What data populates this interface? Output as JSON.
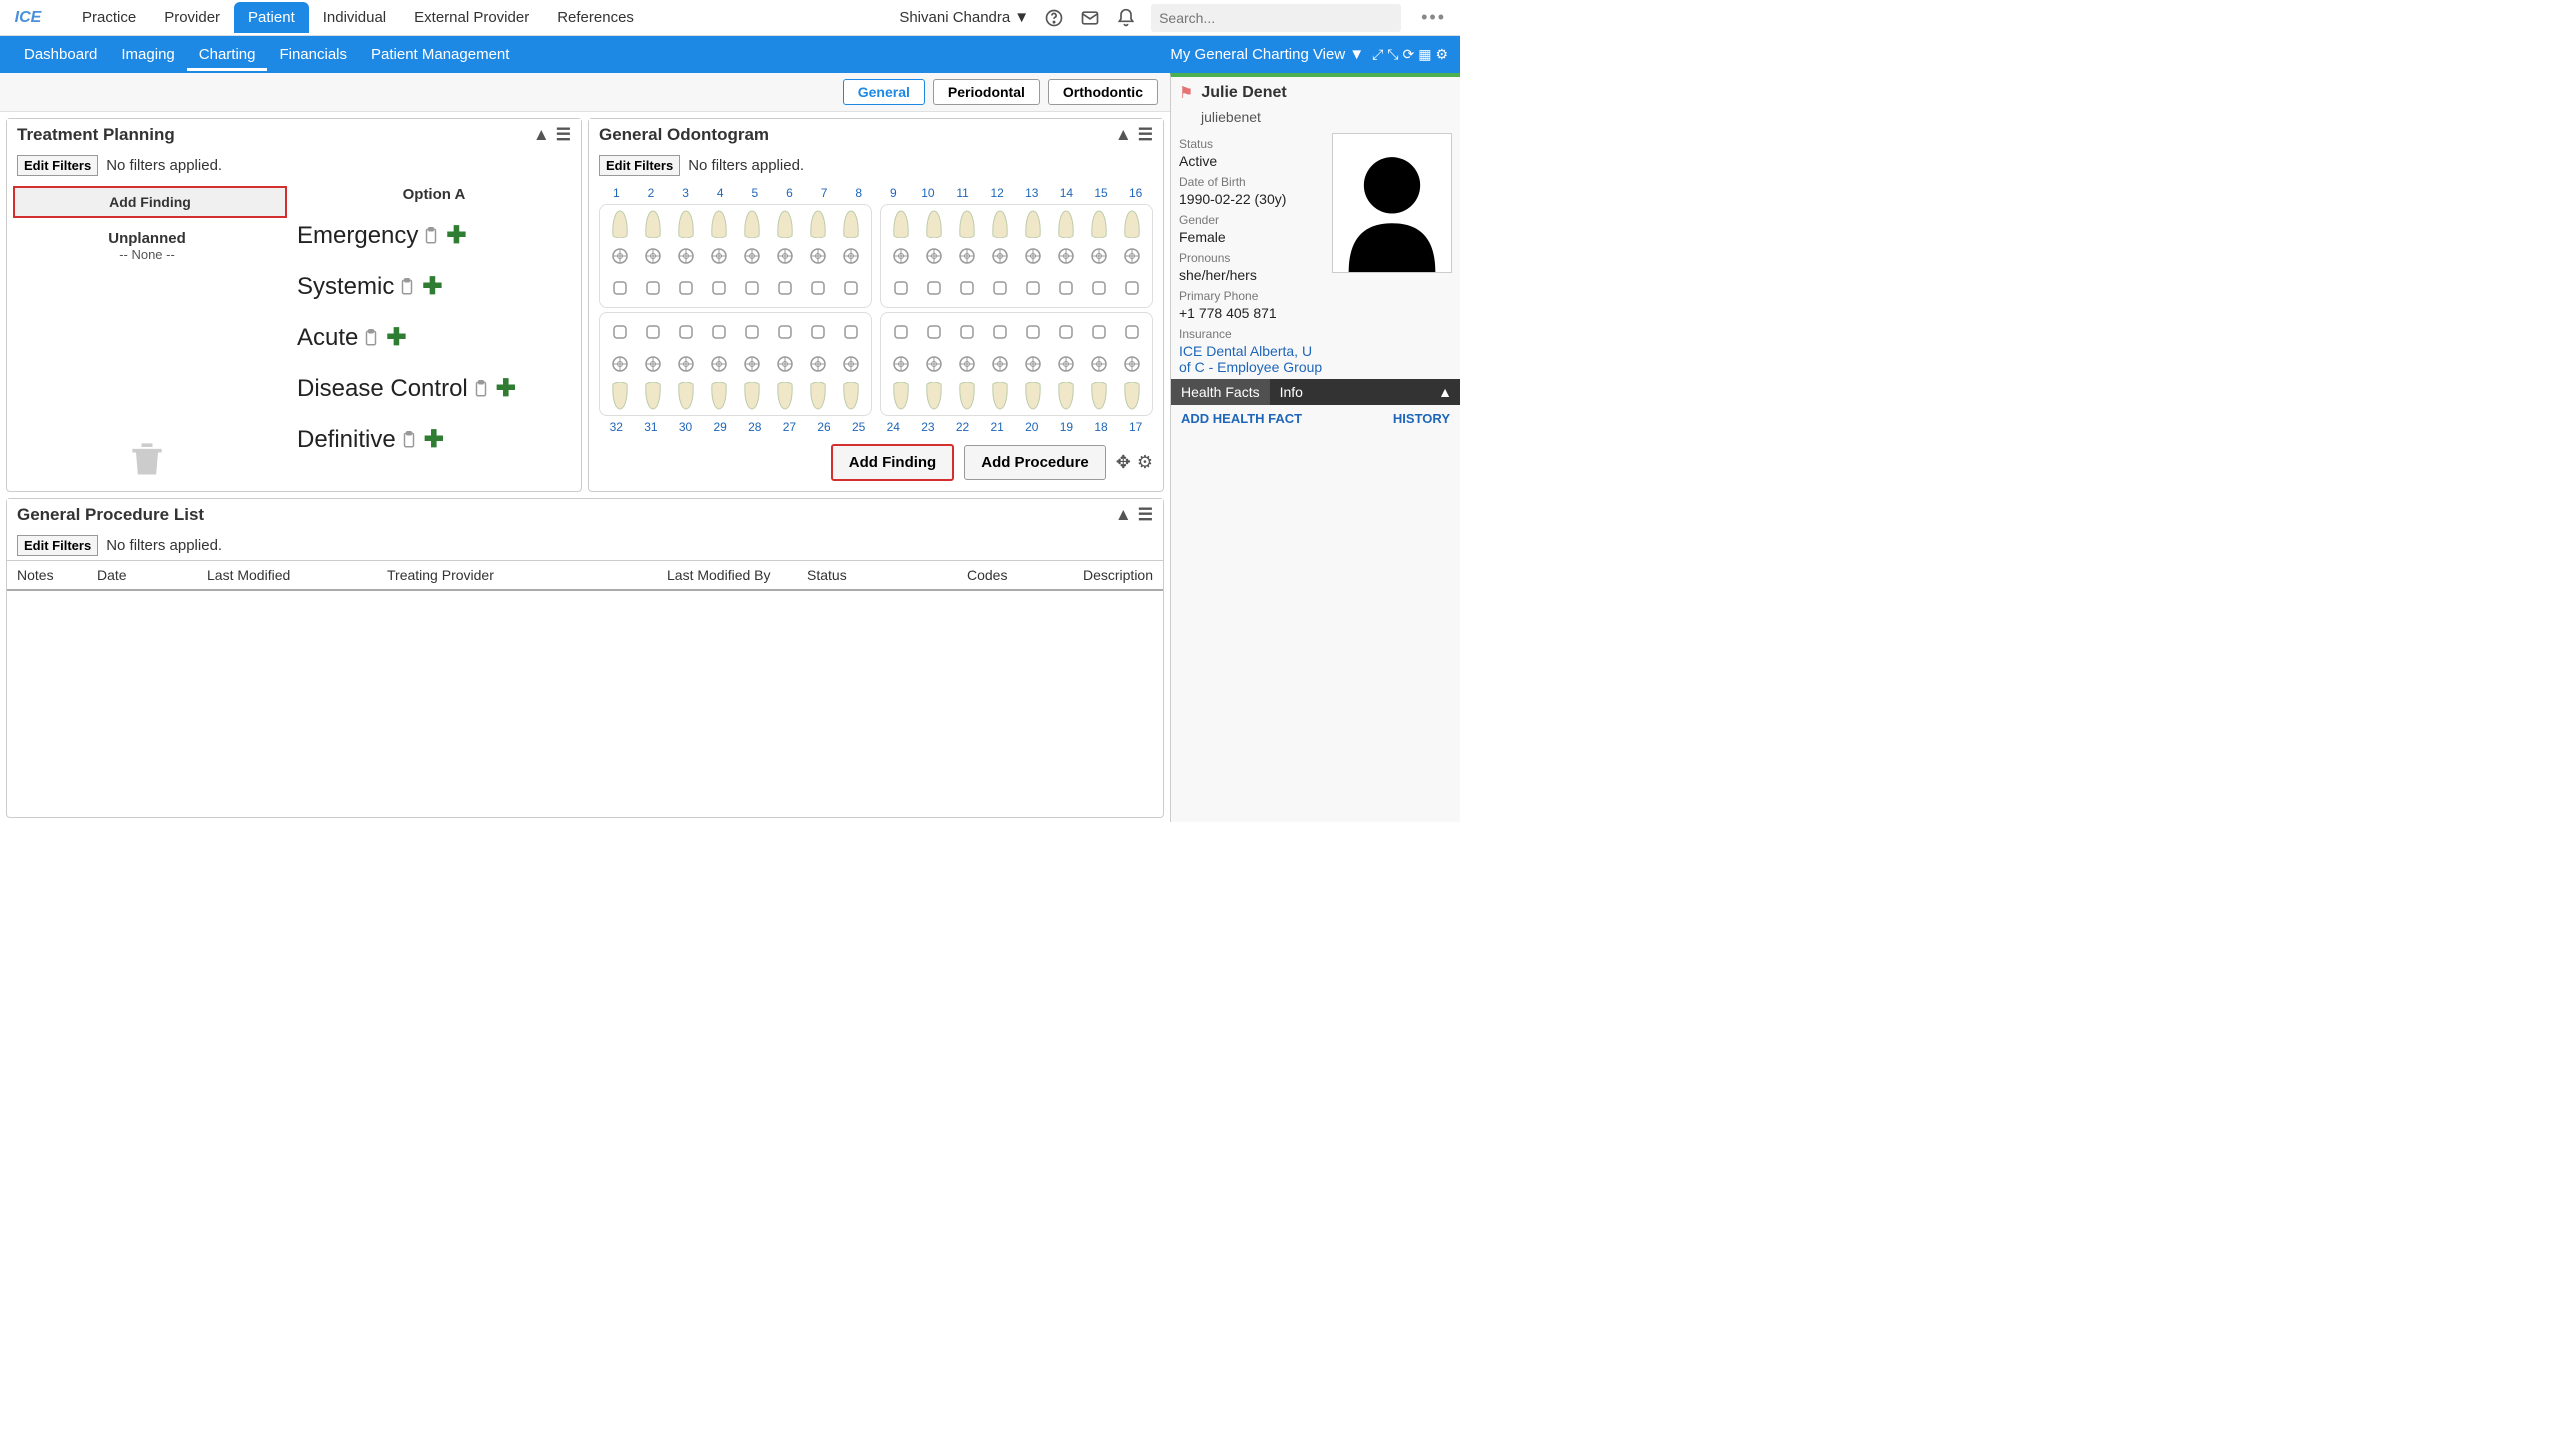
{
  "topnav": [
    "Practice",
    "Provider",
    "Patient",
    "Individual",
    "External Provider",
    "References"
  ],
  "topnav_active": 2,
  "user": "Shivani Chandra",
  "search_placeholder": "Search...",
  "subnav": [
    "Dashboard",
    "Imaging",
    "Charting",
    "Financials",
    "Patient Management"
  ],
  "subnav_active": 2,
  "charting_view": "My General Charting View",
  "view_tabs": [
    "General",
    "Periodontal",
    "Orthodontic"
  ],
  "view_tab_active": 0,
  "panels": {
    "tp": {
      "title": "Treatment Planning",
      "edit_filters": "Edit Filters",
      "no_filters": "No filters applied.",
      "add_finding": "Add Finding",
      "unplanned_title": "Unplanned",
      "unplanned_none": "-- None --",
      "option_a": "Option A",
      "phases": [
        "Emergency",
        "Systemic",
        "Acute",
        "Disease Control",
        "Definitive"
      ]
    },
    "odo": {
      "title": "General Odontogram",
      "edit_filters": "Edit Filters",
      "no_filters": "No filters applied.",
      "add_finding": "Add Finding",
      "add_procedure": "Add Procedure",
      "upper_nums": [
        "1",
        "2",
        "3",
        "4",
        "5",
        "6",
        "7",
        "8",
        "9",
        "10",
        "11",
        "12",
        "13",
        "14",
        "15",
        "16"
      ],
      "lower_nums": [
        "32",
        "31",
        "30",
        "29",
        "28",
        "27",
        "26",
        "25",
        "24",
        "23",
        "22",
        "21",
        "20",
        "19",
        "18",
        "17"
      ]
    },
    "proc": {
      "title": "General Procedure List",
      "edit_filters": "Edit Filters",
      "no_filters": "No filters applied.",
      "columns": [
        "Notes",
        "Date",
        "Last Modified",
        "Treating Provider",
        "Last Modified By",
        "Status",
        "Codes",
        "Description"
      ]
    }
  },
  "patient": {
    "name": "Julie Denet",
    "username": "juliebenet",
    "status_label": "Status",
    "status": "Active",
    "dob_label": "Date of Birth",
    "dob": "1990-02-22 (30y)",
    "gender_label": "Gender",
    "gender": "Female",
    "pronouns_label": "Pronouns",
    "pronouns": "she/her/hers",
    "phone_label": "Primary Phone",
    "phone": "+1 778 405 871",
    "insurance_label": "Insurance",
    "insurance": "ICE Dental Alberta, U of C - Employee Group",
    "tabs": [
      "Health Facts",
      "Info"
    ],
    "add_health_fact": "ADD HEALTH FACT",
    "history": "HISTORY"
  }
}
